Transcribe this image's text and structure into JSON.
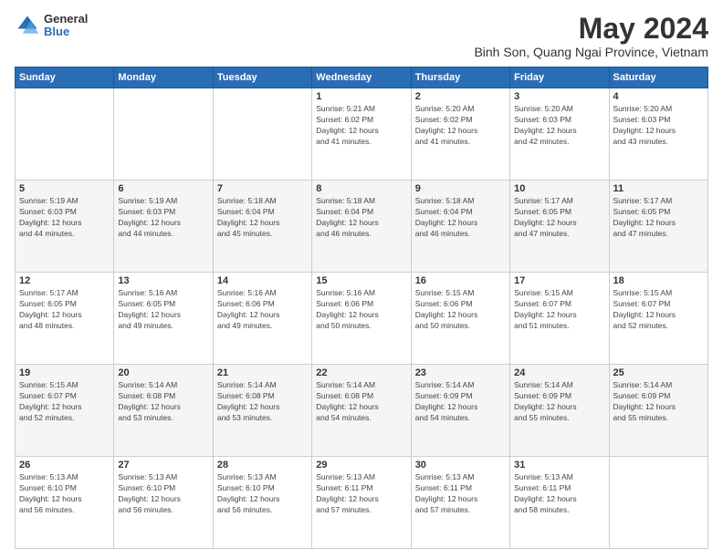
{
  "logo": {
    "general": "General",
    "blue": "Blue"
  },
  "header": {
    "title": "May 2024",
    "subtitle": "Binh Son, Quang Ngai Province, Vietnam"
  },
  "weekdays": [
    "Sunday",
    "Monday",
    "Tuesday",
    "Wednesday",
    "Thursday",
    "Friday",
    "Saturday"
  ],
  "weeks": [
    [
      {
        "day": "",
        "info": ""
      },
      {
        "day": "",
        "info": ""
      },
      {
        "day": "",
        "info": ""
      },
      {
        "day": "1",
        "info": "Sunrise: 5:21 AM\nSunset: 6:02 PM\nDaylight: 12 hours\nand 41 minutes."
      },
      {
        "day": "2",
        "info": "Sunrise: 5:20 AM\nSunset: 6:02 PM\nDaylight: 12 hours\nand 41 minutes."
      },
      {
        "day": "3",
        "info": "Sunrise: 5:20 AM\nSunset: 6:03 PM\nDaylight: 12 hours\nand 42 minutes."
      },
      {
        "day": "4",
        "info": "Sunrise: 5:20 AM\nSunset: 6:03 PM\nDaylight: 12 hours\nand 43 minutes."
      }
    ],
    [
      {
        "day": "5",
        "info": "Sunrise: 5:19 AM\nSunset: 6:03 PM\nDaylight: 12 hours\nand 44 minutes."
      },
      {
        "day": "6",
        "info": "Sunrise: 5:19 AM\nSunset: 6:03 PM\nDaylight: 12 hours\nand 44 minutes."
      },
      {
        "day": "7",
        "info": "Sunrise: 5:18 AM\nSunset: 6:04 PM\nDaylight: 12 hours\nand 45 minutes."
      },
      {
        "day": "8",
        "info": "Sunrise: 5:18 AM\nSunset: 6:04 PM\nDaylight: 12 hours\nand 46 minutes."
      },
      {
        "day": "9",
        "info": "Sunrise: 5:18 AM\nSunset: 6:04 PM\nDaylight: 12 hours\nand 46 minutes."
      },
      {
        "day": "10",
        "info": "Sunrise: 5:17 AM\nSunset: 6:05 PM\nDaylight: 12 hours\nand 47 minutes."
      },
      {
        "day": "11",
        "info": "Sunrise: 5:17 AM\nSunset: 6:05 PM\nDaylight: 12 hours\nand 47 minutes."
      }
    ],
    [
      {
        "day": "12",
        "info": "Sunrise: 5:17 AM\nSunset: 6:05 PM\nDaylight: 12 hours\nand 48 minutes."
      },
      {
        "day": "13",
        "info": "Sunrise: 5:16 AM\nSunset: 6:05 PM\nDaylight: 12 hours\nand 49 minutes."
      },
      {
        "day": "14",
        "info": "Sunrise: 5:16 AM\nSunset: 6:06 PM\nDaylight: 12 hours\nand 49 minutes."
      },
      {
        "day": "15",
        "info": "Sunrise: 5:16 AM\nSunset: 6:06 PM\nDaylight: 12 hours\nand 50 minutes."
      },
      {
        "day": "16",
        "info": "Sunrise: 5:15 AM\nSunset: 6:06 PM\nDaylight: 12 hours\nand 50 minutes."
      },
      {
        "day": "17",
        "info": "Sunrise: 5:15 AM\nSunset: 6:07 PM\nDaylight: 12 hours\nand 51 minutes."
      },
      {
        "day": "18",
        "info": "Sunrise: 5:15 AM\nSunset: 6:07 PM\nDaylight: 12 hours\nand 52 minutes."
      }
    ],
    [
      {
        "day": "19",
        "info": "Sunrise: 5:15 AM\nSunset: 6:07 PM\nDaylight: 12 hours\nand 52 minutes."
      },
      {
        "day": "20",
        "info": "Sunrise: 5:14 AM\nSunset: 6:08 PM\nDaylight: 12 hours\nand 53 minutes."
      },
      {
        "day": "21",
        "info": "Sunrise: 5:14 AM\nSunset: 6:08 PM\nDaylight: 12 hours\nand 53 minutes."
      },
      {
        "day": "22",
        "info": "Sunrise: 5:14 AM\nSunset: 6:08 PM\nDaylight: 12 hours\nand 54 minutes."
      },
      {
        "day": "23",
        "info": "Sunrise: 5:14 AM\nSunset: 6:09 PM\nDaylight: 12 hours\nand 54 minutes."
      },
      {
        "day": "24",
        "info": "Sunrise: 5:14 AM\nSunset: 6:09 PM\nDaylight: 12 hours\nand 55 minutes."
      },
      {
        "day": "25",
        "info": "Sunrise: 5:14 AM\nSunset: 6:09 PM\nDaylight: 12 hours\nand 55 minutes."
      }
    ],
    [
      {
        "day": "26",
        "info": "Sunrise: 5:13 AM\nSunset: 6:10 PM\nDaylight: 12 hours\nand 56 minutes."
      },
      {
        "day": "27",
        "info": "Sunrise: 5:13 AM\nSunset: 6:10 PM\nDaylight: 12 hours\nand 56 minutes."
      },
      {
        "day": "28",
        "info": "Sunrise: 5:13 AM\nSunset: 6:10 PM\nDaylight: 12 hours\nand 56 minutes."
      },
      {
        "day": "29",
        "info": "Sunrise: 5:13 AM\nSunset: 6:11 PM\nDaylight: 12 hours\nand 57 minutes."
      },
      {
        "day": "30",
        "info": "Sunrise: 5:13 AM\nSunset: 6:11 PM\nDaylight: 12 hours\nand 57 minutes."
      },
      {
        "day": "31",
        "info": "Sunrise: 5:13 AM\nSunset: 6:11 PM\nDaylight: 12 hours\nand 58 minutes."
      },
      {
        "day": "",
        "info": ""
      }
    ]
  ]
}
